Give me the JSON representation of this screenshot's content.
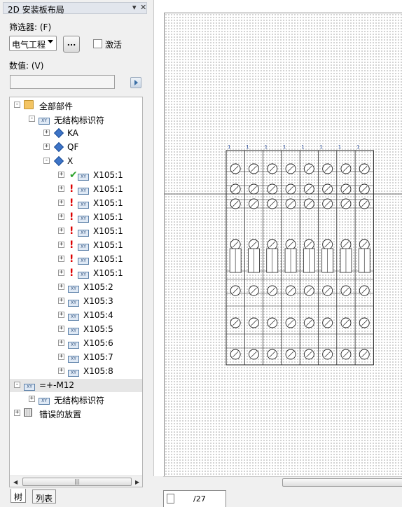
{
  "panel": {
    "title": "2D 安装板布局",
    "pin": "▾",
    "close": "✕",
    "filter_label": "筛选器: (F)",
    "filter_value": "电气工程",
    "dots_label": "...",
    "activate_label": "激活",
    "value_label": "数值: (V)",
    "value_input": ""
  },
  "tree": {
    "nodes": [
      {
        "label": "全部部件"
      },
      {
        "label": "无结构标识符"
      },
      {
        "label": "KA"
      },
      {
        "label": "QF"
      },
      {
        "label": "X"
      },
      {
        "label": "X105:1",
        "status": "placed"
      },
      {
        "label": "X105:1",
        "status": "error"
      },
      {
        "label": "X105:1",
        "status": "error"
      },
      {
        "label": "X105:1",
        "status": "error"
      },
      {
        "label": "X105:1",
        "status": "error"
      },
      {
        "label": "X105:1",
        "status": "error"
      },
      {
        "label": "X105:1",
        "status": "error"
      },
      {
        "label": "X105:1",
        "status": "error"
      },
      {
        "label": "X105:2"
      },
      {
        "label": "X105:3"
      },
      {
        "label": "X105:4"
      },
      {
        "label": "X105:5"
      },
      {
        "label": "X105:6"
      },
      {
        "label": "X105:7"
      },
      {
        "label": "X105:8"
      },
      {
        "label": "=+-M12"
      },
      {
        "label": "无结构标识符"
      },
      {
        "label": "错误的放置"
      }
    ],
    "scroll_grip": "|||"
  },
  "tabs": {
    "tree": "树",
    "list": "列表"
  },
  "canvas": {
    "terminal_marks": [
      "1",
      "1",
      "1",
      "1",
      "1",
      "1",
      "1",
      "1"
    ],
    "page_label": "/27"
  },
  "colors": {
    "error": "#dd0000",
    "ok": "#2aa22a",
    "diamond": "#3d74c7"
  }
}
